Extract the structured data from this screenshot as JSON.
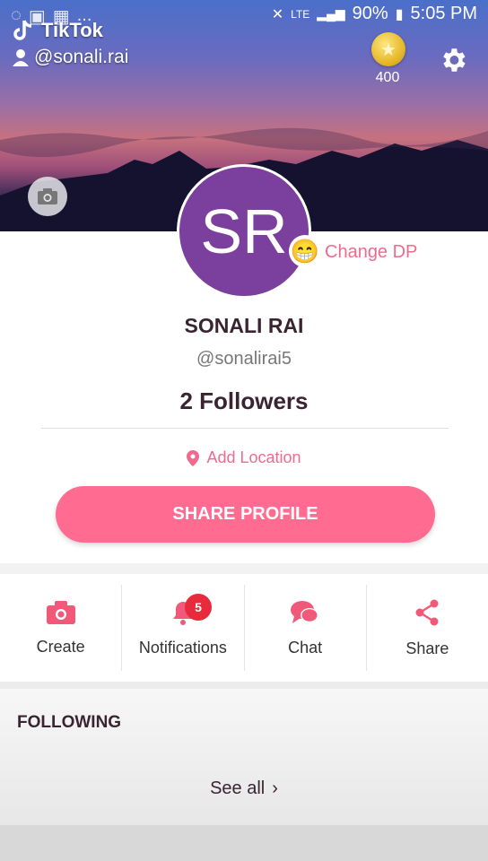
{
  "status": {
    "battery": "90%",
    "time": "5:05 PM",
    "network_label": "LTE",
    "dots": "..."
  },
  "watermark": {
    "app_name": "TikTok",
    "username": "@sonali.rai"
  },
  "header": {
    "coins": "400",
    "icons": [
      "settings-gear-icon",
      "camera-icon",
      "coin-icon"
    ]
  },
  "profile": {
    "initials": "SR",
    "change_dp_label": "Change DP",
    "name": "SONALI RAI",
    "handle": "@sonalirai5",
    "followers_label": "2 Followers",
    "add_location_label": "Add Location",
    "share_button_label": "SHARE PROFILE"
  },
  "actions": [
    {
      "label": "Create",
      "icon": "camera-icon"
    },
    {
      "label": "Notifications",
      "icon": "bell-icon",
      "badge": "5"
    },
    {
      "label": "Chat",
      "icon": "chat-bubbles-icon"
    },
    {
      "label": "Share",
      "icon": "share-icon"
    }
  ],
  "following": {
    "title": "FOLLOWING",
    "see_all_label": "See all"
  },
  "colors": {
    "accent": "#ff6b91",
    "accent_text": "#f06a8f",
    "avatar_bg": "#7b3f9e",
    "badge": "#e82a3d"
  }
}
